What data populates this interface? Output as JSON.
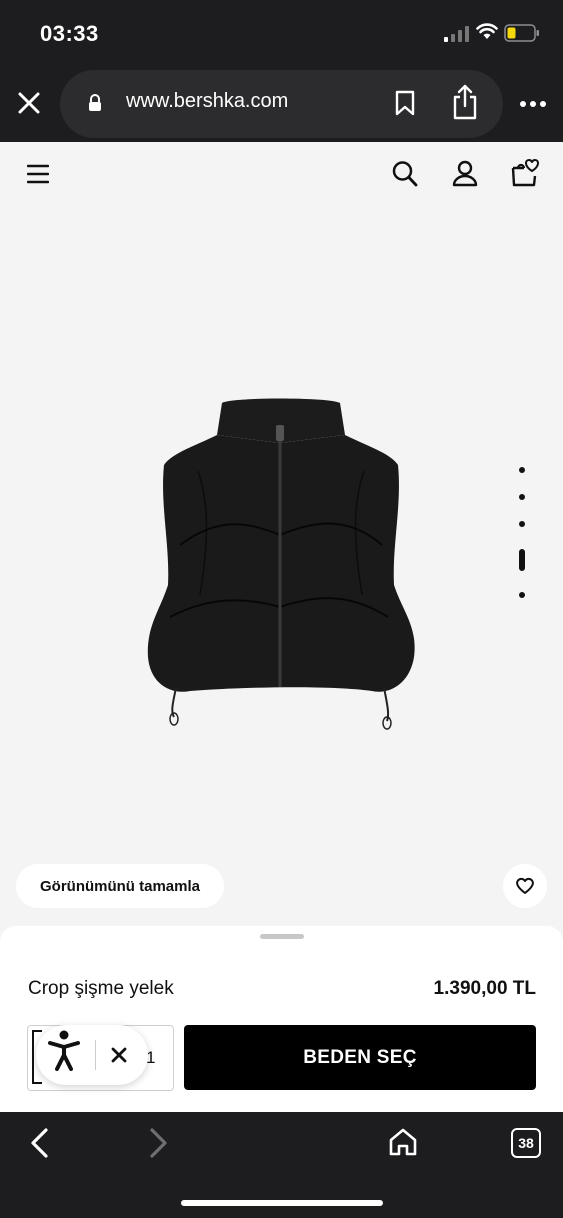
{
  "status_bar": {
    "time": "03:33"
  },
  "browser": {
    "url": "www.bershka.com",
    "tab_count": "38"
  },
  "product": {
    "name": "Crop şişme yelek",
    "price": "1.390,00 TL",
    "image_dots_count": 5,
    "active_image_index": 3
  },
  "actions": {
    "complete_look_label": "Görünümünü tamamla",
    "select_size_label": "BEDEN SEÇ",
    "quantity": "1"
  },
  "colors": {
    "chrome_dark": "#1d1d1f",
    "button_black": "#000000",
    "background": "#f4f4f4",
    "battery_low": "#f5d90a"
  },
  "icons": [
    "close-icon",
    "lock-icon",
    "bookmark-icon",
    "share-icon",
    "more-icon",
    "menu-icon",
    "search-icon",
    "user-icon",
    "bag-wishlist-icon",
    "heart-icon",
    "accessibility-icon",
    "back-icon",
    "forward-icon",
    "home-icon",
    "tabs-icon"
  ]
}
